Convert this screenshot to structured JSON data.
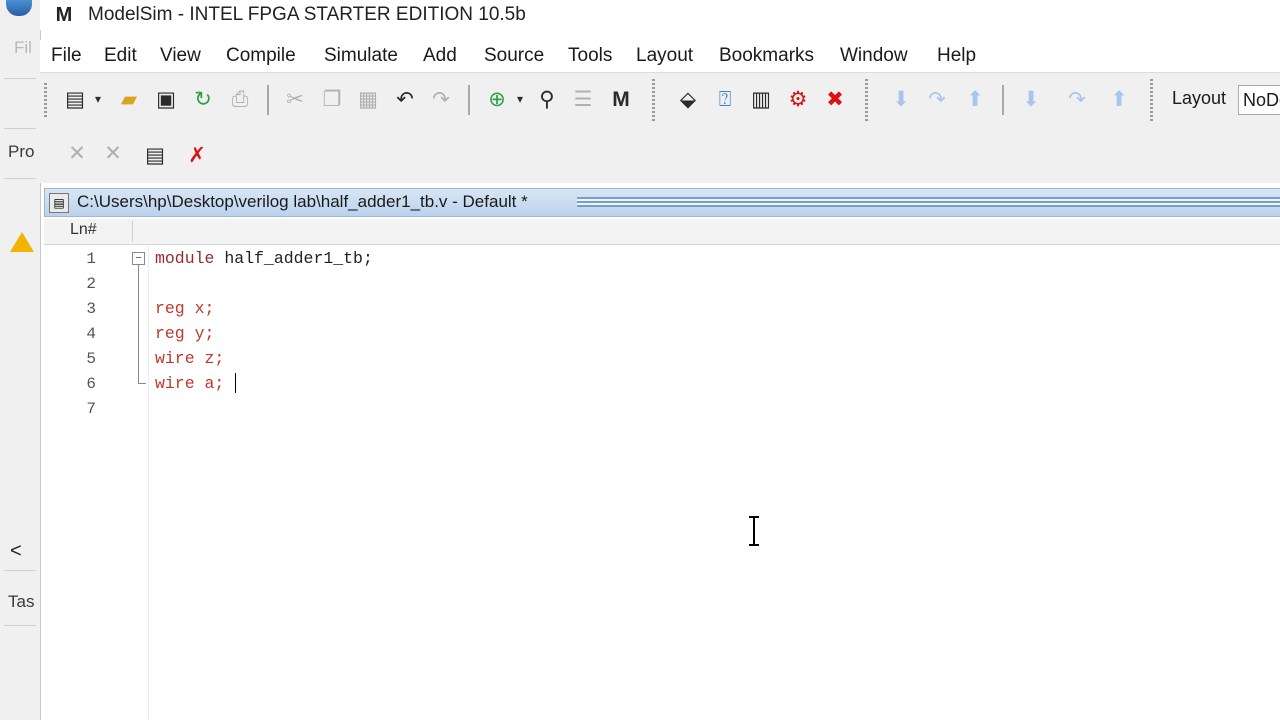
{
  "window": {
    "title": "ModelSim - INTEL FPGA STARTER EDITION 10.5b",
    "logo": "M"
  },
  "background_window": {
    "partial_labels": [
      "Fil",
      "Pro",
      "Tas"
    ],
    "scroll_arrow": "<"
  },
  "menu": [
    "File",
    "Edit",
    "View",
    "Compile",
    "Simulate",
    "Add",
    "Source",
    "Tools",
    "Layout",
    "Bookmarks",
    "Window",
    "Help"
  ],
  "toolbar": {
    "layout_label": "Layout",
    "layout_value": "NoDesign"
  },
  "document": {
    "path": "C:\\Users\\hp\\Desktop\\verilog lab\\half_adder1_tb.v - Default *",
    "column_header": "Ln#"
  },
  "editor": {
    "lines": [
      {
        "num": "1",
        "keyword": "module",
        "rest": " half_adder1_tb;"
      },
      {
        "num": "2",
        "keyword": "",
        "rest": ""
      },
      {
        "num": "3",
        "keyword": "reg",
        "rest": " x;"
      },
      {
        "num": "4",
        "keyword": "reg",
        "rest": " y;"
      },
      {
        "num": "5",
        "keyword": "wire",
        "rest": " z;"
      },
      {
        "num": "6",
        "keyword": "wire",
        "rest": " a;"
      },
      {
        "num": "7",
        "keyword": "",
        "rest": ""
      }
    ]
  },
  "colors": {
    "keyword": "#c0392b",
    "doc_header": "#bcd2ec",
    "toolbar_bg": "#f0f0f0"
  }
}
